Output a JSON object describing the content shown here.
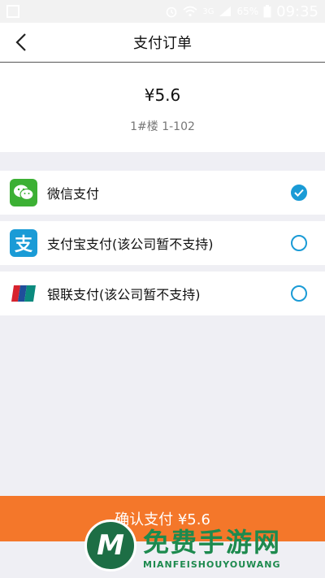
{
  "status_bar": {
    "signal_label": "3G",
    "battery": "65%",
    "time": "09:35"
  },
  "header": {
    "title": "支付订单"
  },
  "order": {
    "price": "¥5.6",
    "room": "1#楼 1-102"
  },
  "payment_methods": [
    {
      "label": "微信支付",
      "icon": "wechat-icon",
      "selected": true
    },
    {
      "label": "支付宝支付(该公司暂不支持)",
      "icon": "alipay-icon",
      "selected": false
    },
    {
      "label": "银联支付(该公司暂不支持)",
      "icon": "unionpay-icon",
      "selected": false
    }
  ],
  "confirm_button": {
    "label": "确认支付 ¥5.6"
  },
  "watermark": {
    "cn": "免费手游网",
    "en": "MIANFEISHOUYOUWANG"
  },
  "colors": {
    "accent": "#f4772a",
    "radio": "#1a9bd6",
    "wechat": "#3cb034",
    "alipay": "#1a9bd6"
  }
}
